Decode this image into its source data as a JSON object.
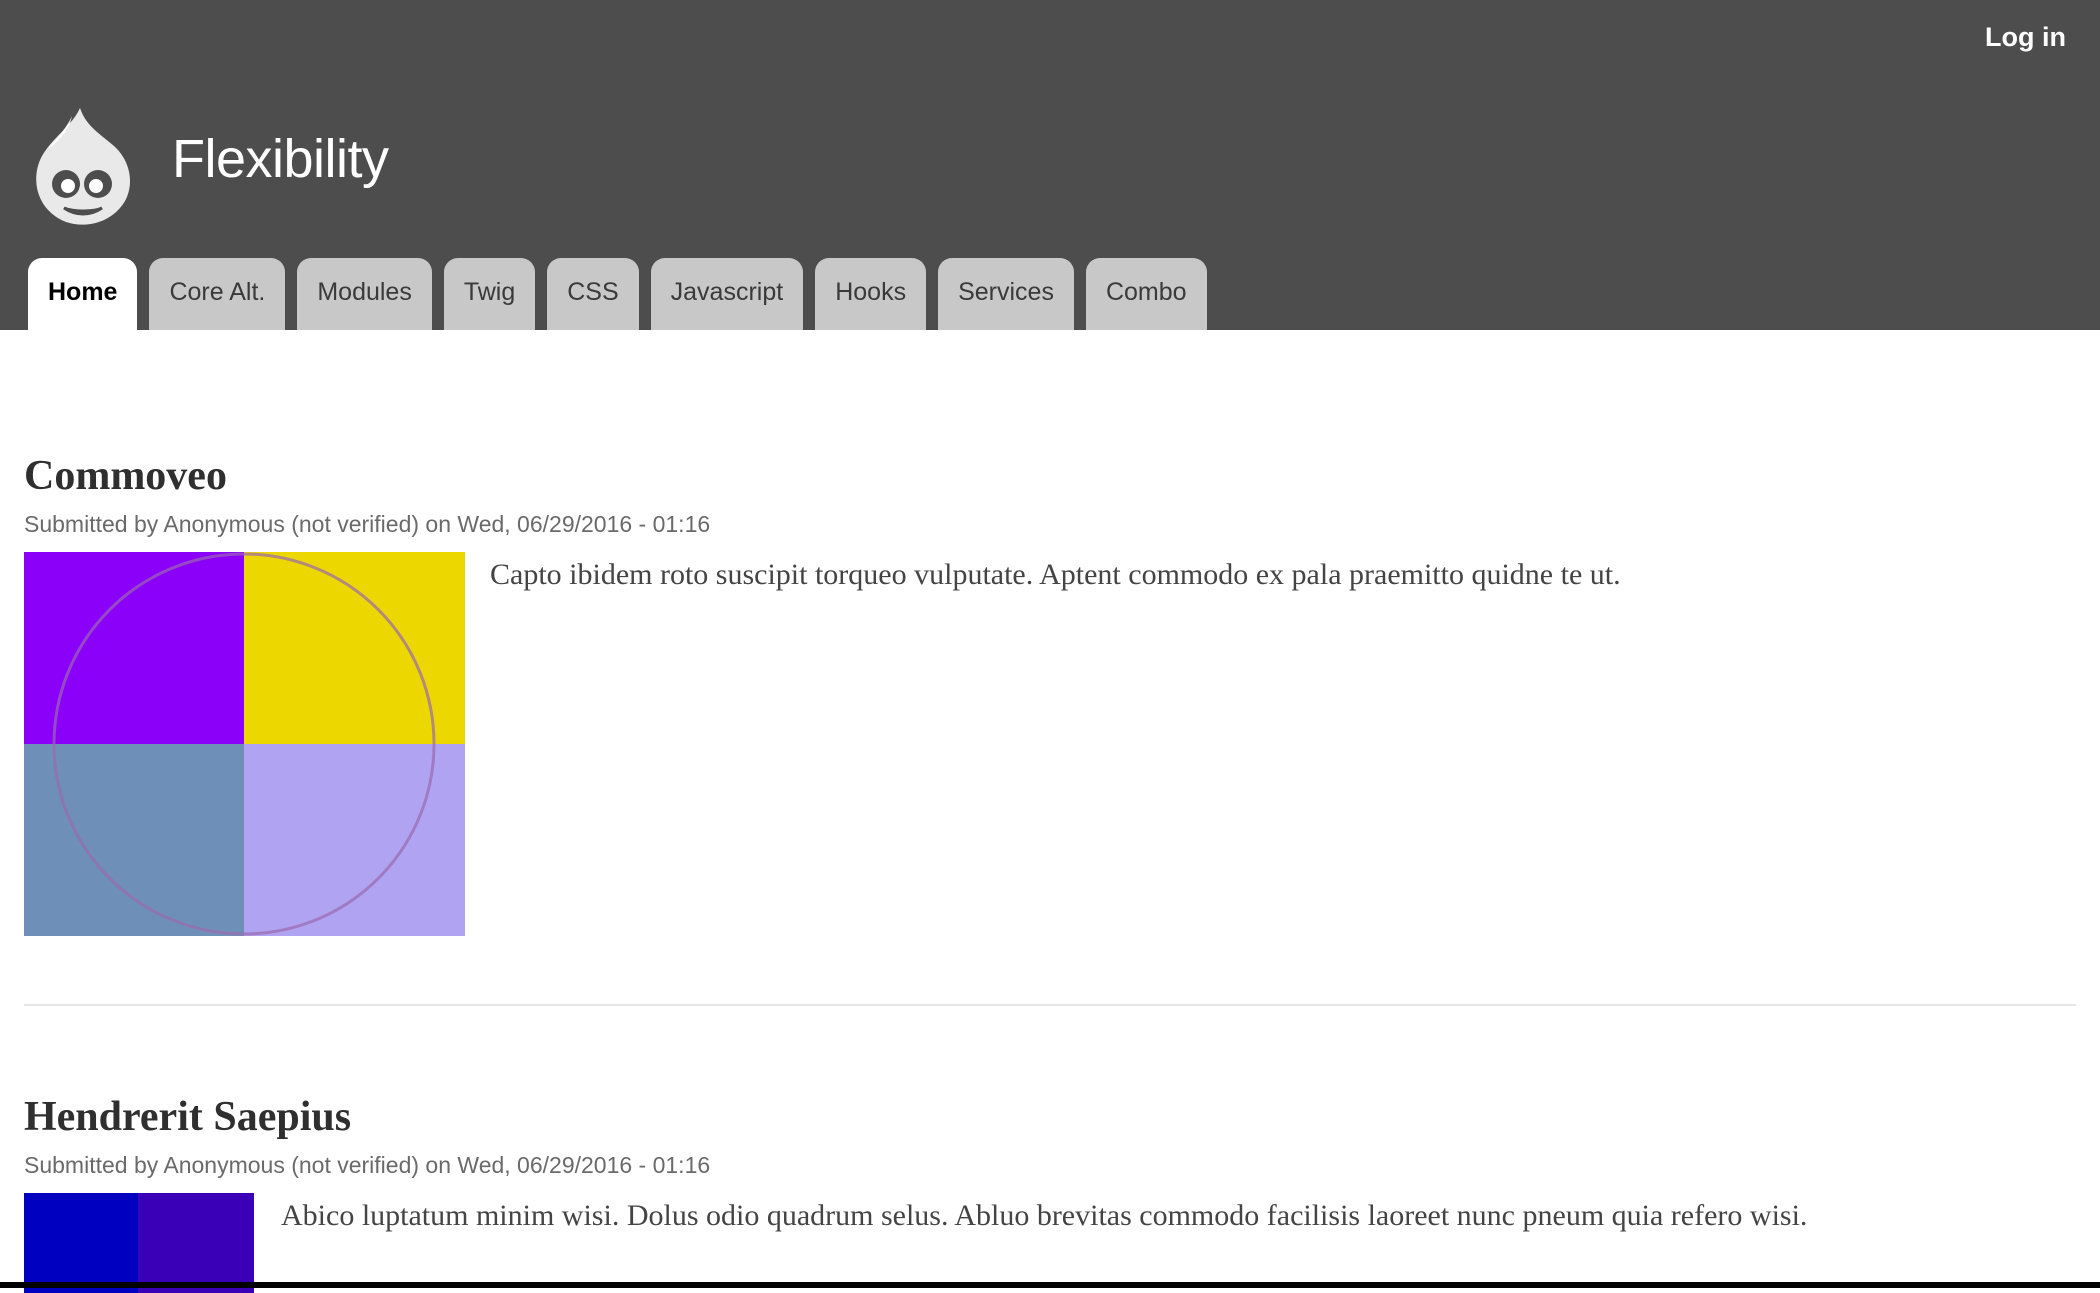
{
  "header": {
    "login_label": "Log in",
    "site_name": "Flexibility",
    "tabs": [
      {
        "label": "Home",
        "active": true
      },
      {
        "label": "Core Alt.",
        "active": false
      },
      {
        "label": "Modules",
        "active": false
      },
      {
        "label": "Twig",
        "active": false
      },
      {
        "label": "CSS",
        "active": false
      },
      {
        "label": "Javascript",
        "active": false
      },
      {
        "label": "Hooks",
        "active": false
      },
      {
        "label": "Services",
        "active": false
      },
      {
        "label": "Combo",
        "active": false
      }
    ]
  },
  "articles": [
    {
      "title": "Commoveo",
      "meta": "Submitted by Anonymous (not verified) on Wed, 06/29/2016 - 01:16",
      "body": "Capto ibidem roto suscipit torqueo vulputate. Aptent commodo ex pala praemitto quidne te ut."
    },
    {
      "title": "Hendrerit Saepius",
      "meta": "Submitted by Anonymous (not verified) on Wed, 06/29/2016 - 01:16",
      "body": "Abico luptatum minim wisi. Dolus odio quadrum selus. Abluo brevitas commodo facilisis laoreet nunc pneum quia refero wisi."
    }
  ],
  "colors": {
    "header_bg": "#4d4d4d",
    "tab_inactive": "#c8c8c8",
    "tab_active": "#ffffff"
  }
}
